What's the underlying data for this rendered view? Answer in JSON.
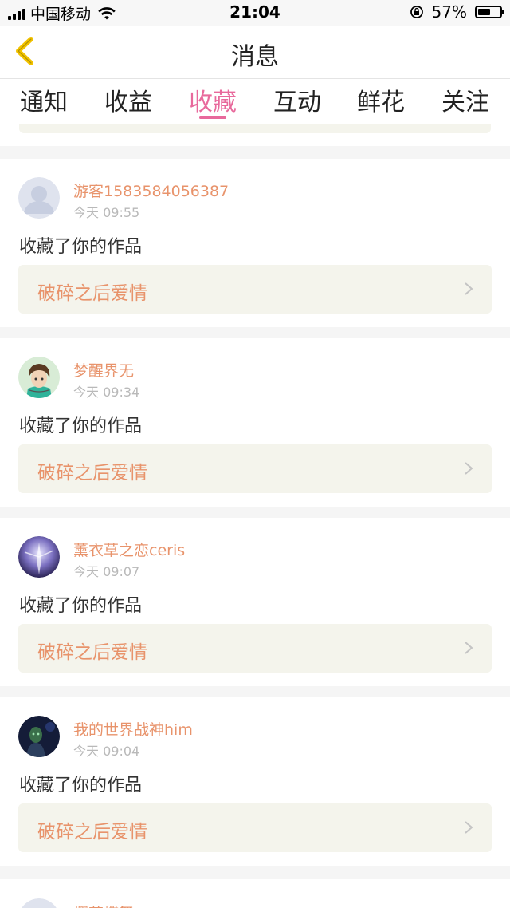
{
  "status_bar": {
    "carrier": "中国移动",
    "time": "21:04",
    "battery_percent": "57%",
    "battery_level": 0.57,
    "icons": [
      "signal-icon",
      "wifi-icon",
      "orientation-lock-icon",
      "battery-icon"
    ]
  },
  "nav": {
    "title": "消息",
    "back_icon": "chevron-left-icon",
    "accent": "#f2c200"
  },
  "tabs": [
    {
      "label": "通知"
    },
    {
      "label": "收益"
    },
    {
      "label": "收藏"
    },
    {
      "label": "互动"
    },
    {
      "label": "鲜花"
    },
    {
      "label": "关注"
    }
  ],
  "active_tab": "收藏",
  "colors": {
    "accent_pink": "#e8699c",
    "name_orange": "#e8936b",
    "box_bg": "#f4f4ec"
  },
  "feed": [
    {
      "username": "游客1583584056387",
      "time": "今天 09:55",
      "action": "收藏了你的作品",
      "work_title": "破碎之后爱情"
    },
    {
      "username": "梦醒界无",
      "time": "今天 09:34",
      "action": "收藏了你的作品",
      "work_title": "破碎之后爱情"
    },
    {
      "username": "薰衣草之恋ceris",
      "time": "今天 09:07",
      "action": "收藏了你的作品",
      "work_title": "破碎之后爱情"
    },
    {
      "username": "我的世界战神him",
      "time": "今天 09:04",
      "action": "收藏了你的作品",
      "work_title": "破碎之后爱情"
    },
    {
      "username": "樱花蝶舞"
    }
  ]
}
